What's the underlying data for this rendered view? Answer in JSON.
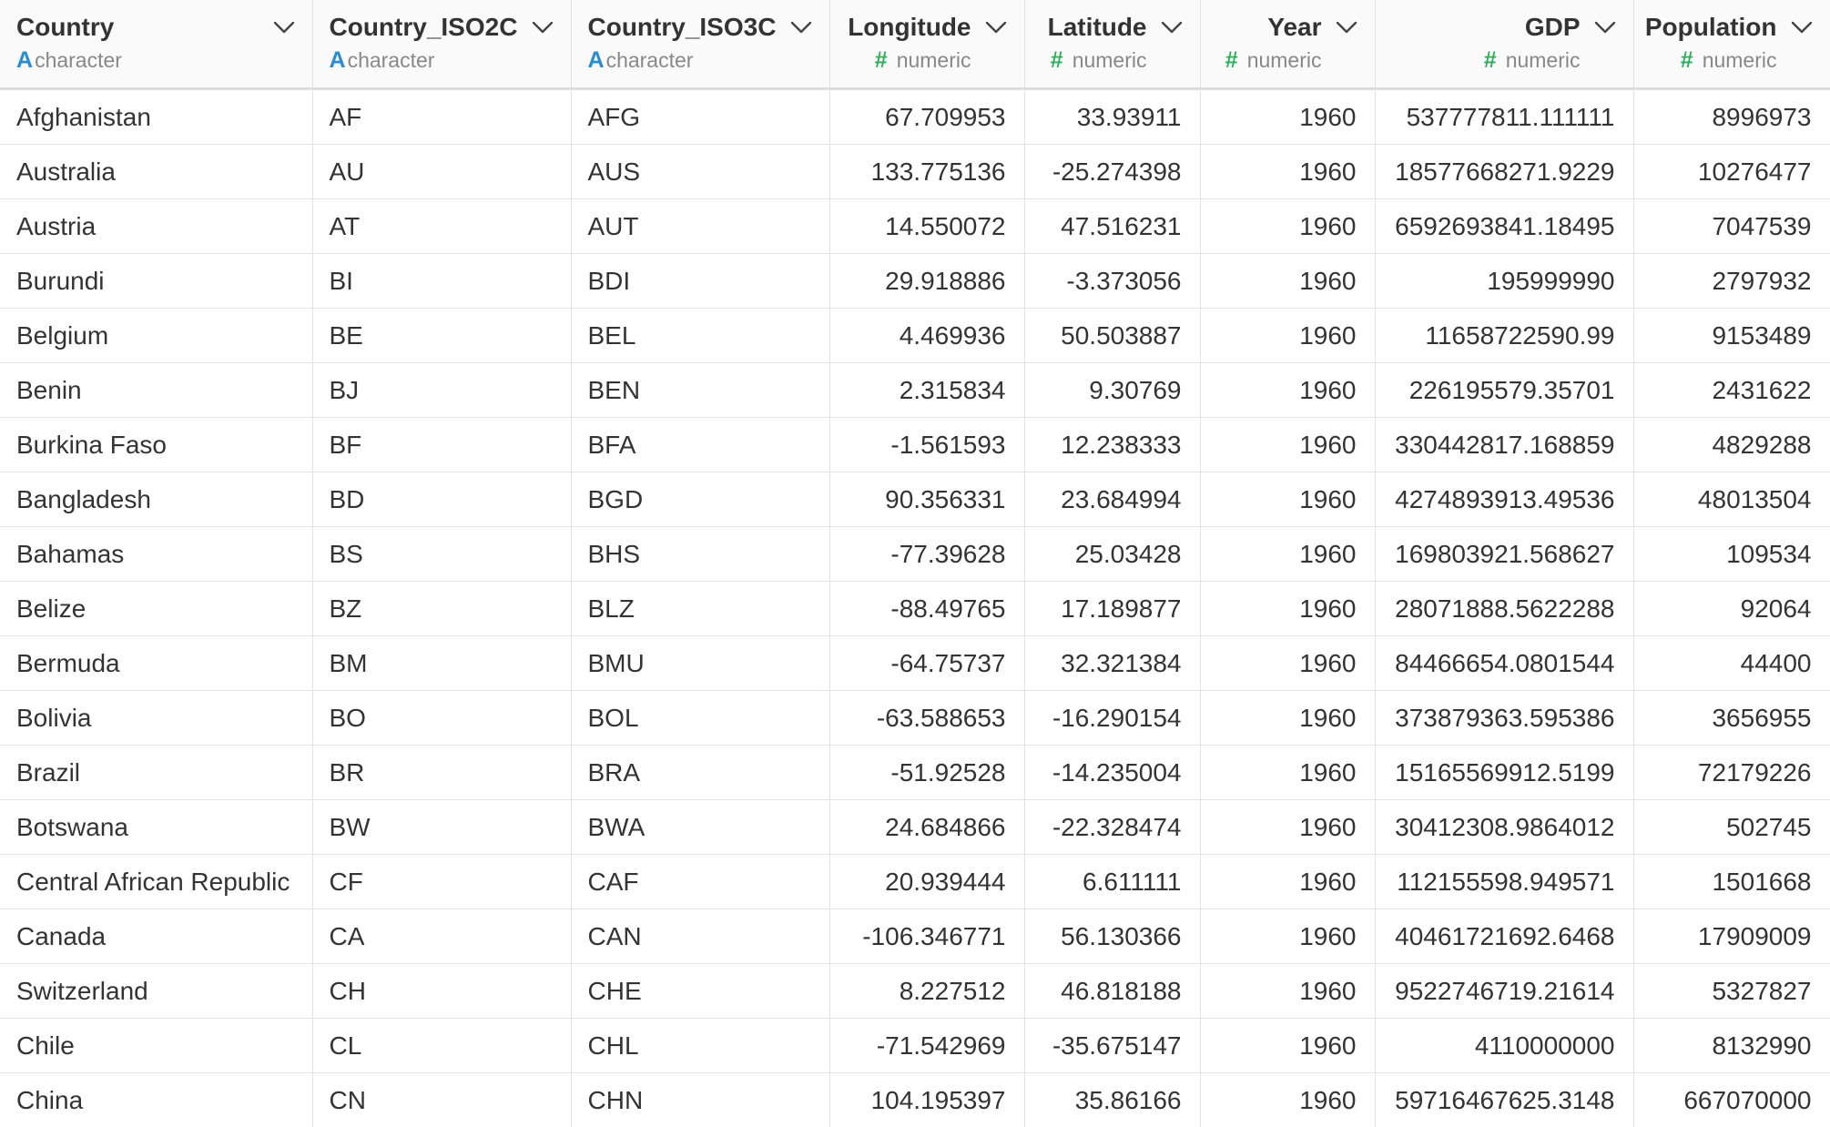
{
  "columns": [
    {
      "name": "Country",
      "type": "character",
      "type_glyph": "A"
    },
    {
      "name": "Country_ISO2C",
      "type": "character",
      "type_glyph": "A"
    },
    {
      "name": "Country_ISO3C",
      "type": "character",
      "type_glyph": "A"
    },
    {
      "name": "Longitude",
      "type": "numeric",
      "type_glyph": "#"
    },
    {
      "name": "Latitude",
      "type": "numeric",
      "type_glyph": "#"
    },
    {
      "name": "Year",
      "type": "numeric",
      "type_glyph": "#"
    },
    {
      "name": "GDP",
      "type": "numeric",
      "type_glyph": "#"
    },
    {
      "name": "Population",
      "type": "numeric",
      "type_glyph": "#"
    }
  ],
  "rows": [
    [
      "Afghanistan",
      "AF",
      "AFG",
      "67.709953",
      "33.93911",
      "1960",
      "537777811.111111",
      "8996973"
    ],
    [
      "Australia",
      "AU",
      "AUS",
      "133.775136",
      "-25.274398",
      "1960",
      "18577668271.9229",
      "10276477"
    ],
    [
      "Austria",
      "AT",
      "AUT",
      "14.550072",
      "47.516231",
      "1960",
      "6592693841.18495",
      "7047539"
    ],
    [
      "Burundi",
      "BI",
      "BDI",
      "29.918886",
      "-3.373056",
      "1960",
      "195999990",
      "2797932"
    ],
    [
      "Belgium",
      "BE",
      "BEL",
      "4.469936",
      "50.503887",
      "1960",
      "11658722590.99",
      "9153489"
    ],
    [
      "Benin",
      "BJ",
      "BEN",
      "2.315834",
      "9.30769",
      "1960",
      "226195579.35701",
      "2431622"
    ],
    [
      "Burkina Faso",
      "BF",
      "BFA",
      "-1.561593",
      "12.238333",
      "1960",
      "330442817.168859",
      "4829288"
    ],
    [
      "Bangladesh",
      "BD",
      "BGD",
      "90.356331",
      "23.684994",
      "1960",
      "4274893913.49536",
      "48013504"
    ],
    [
      "Bahamas",
      "BS",
      "BHS",
      "-77.39628",
      "25.03428",
      "1960",
      "169803921.568627",
      "109534"
    ],
    [
      "Belize",
      "BZ",
      "BLZ",
      "-88.49765",
      "17.189877",
      "1960",
      "28071888.5622288",
      "92064"
    ],
    [
      "Bermuda",
      "BM",
      "BMU",
      "-64.75737",
      "32.321384",
      "1960",
      "84466654.0801544",
      "44400"
    ],
    [
      "Bolivia",
      "BO",
      "BOL",
      "-63.588653",
      "-16.290154",
      "1960",
      "373879363.595386",
      "3656955"
    ],
    [
      "Brazil",
      "BR",
      "BRA",
      "-51.92528",
      "-14.235004",
      "1960",
      "15165569912.5199",
      "72179226"
    ],
    [
      "Botswana",
      "BW",
      "BWA",
      "24.684866",
      "-22.328474",
      "1960",
      "30412308.9864012",
      "502745"
    ],
    [
      "Central African Republic",
      "CF",
      "CAF",
      "20.939444",
      "6.611111",
      "1960",
      "112155598.949571",
      "1501668"
    ],
    [
      "Canada",
      "CA",
      "CAN",
      "-106.346771",
      "56.130366",
      "1960",
      "40461721692.6468",
      "17909009"
    ],
    [
      "Switzerland",
      "CH",
      "CHE",
      "8.227512",
      "46.818188",
      "1960",
      "9522746719.21614",
      "5327827"
    ],
    [
      "Chile",
      "CL",
      "CHL",
      "-71.542969",
      "-35.675147",
      "1960",
      "4110000000",
      "8132990"
    ],
    [
      "China",
      "CN",
      "CHN",
      "104.195397",
      "35.86166",
      "1960",
      "59716467625.3148",
      "667070000"
    ]
  ],
  "icons": {
    "column_menu": "chevron-down-icon",
    "character_type": "character-type-icon",
    "numeric_type": "numeric-type-icon"
  },
  "colors": {
    "character_type": "#2a8dd4",
    "numeric_type": "#2fae5a"
  }
}
